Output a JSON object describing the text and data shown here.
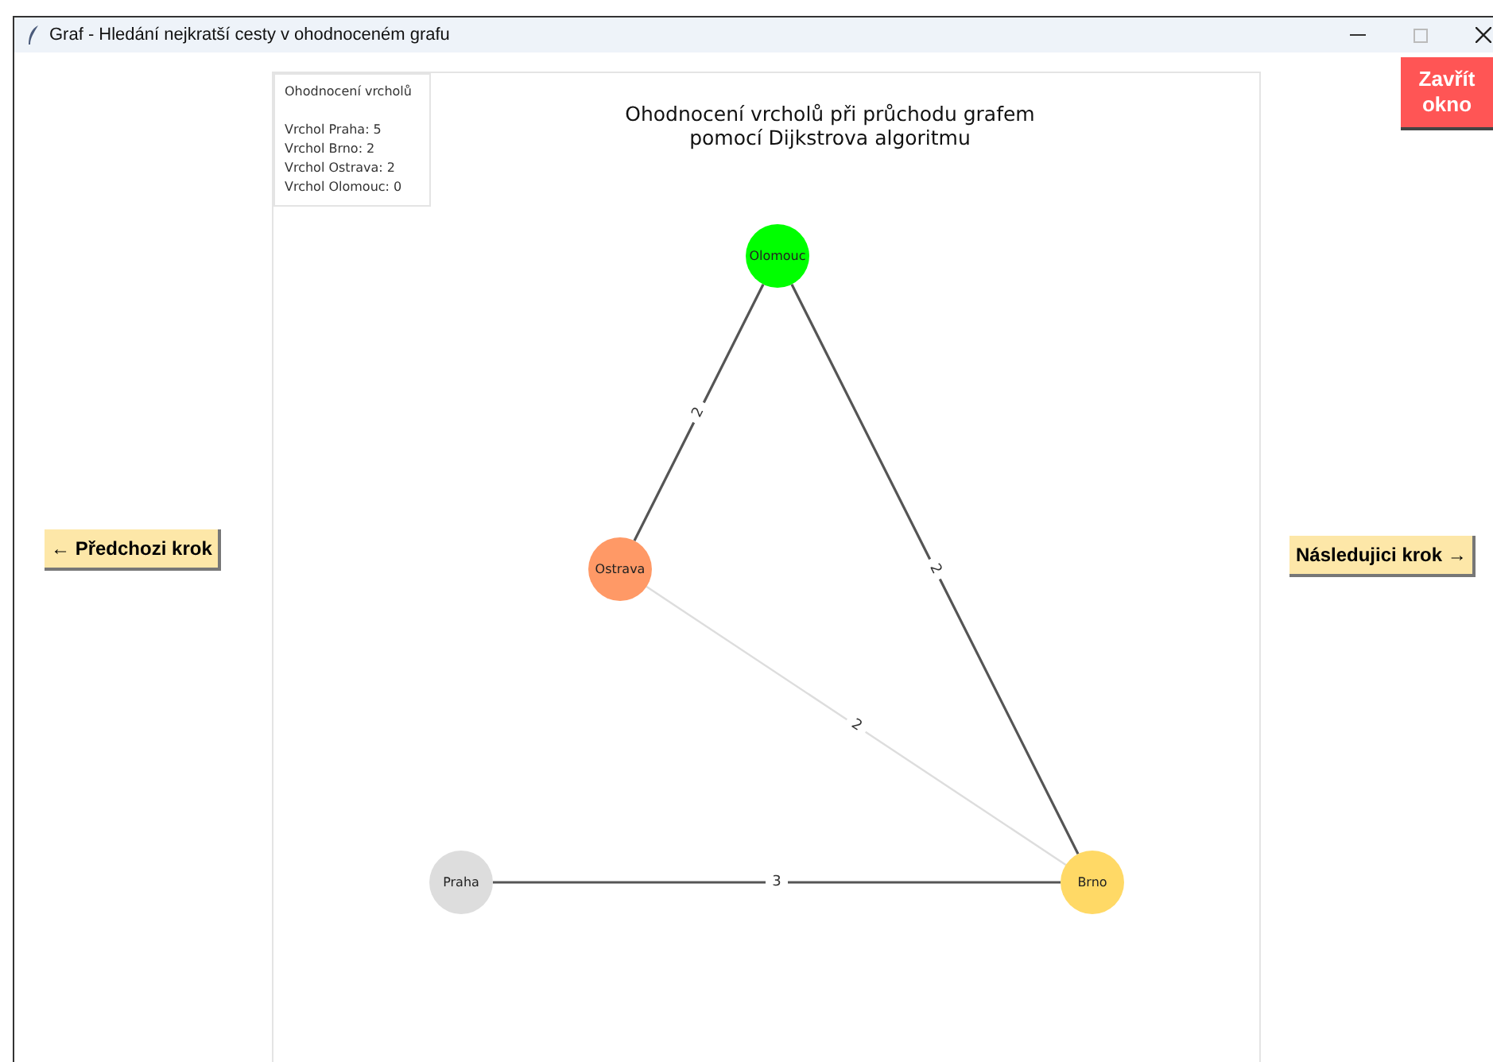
{
  "window": {
    "title": "Graf - Hledání nejkratší cesty v ohodnoceném grafu"
  },
  "close_button": {
    "label": "Zavřít okno"
  },
  "prev_button": {
    "label": "← Předchozi krok"
  },
  "next_button": {
    "label": "Následujici krok →"
  },
  "figure": {
    "title_lines": [
      "Ohodnocení vrcholů při průchodu grafem",
      "pomocí Dijkstrova algoritmu"
    ],
    "legend": {
      "title": "Ohodnocení vrcholů",
      "items": [
        "Vrchol Praha: 5",
        "Vrchol Brno: 2",
        "Vrchol Ostrava: 2",
        "Vrchol Olomouc: 0"
      ]
    },
    "nodes": [
      {
        "label": "Olomouc",
        "color": "#00ff00"
      },
      {
        "label": "Ostrava",
        "color": "#ff9966"
      },
      {
        "label": "Praha",
        "color": "#dddddd"
      },
      {
        "label": "Brno",
        "color": "#ffd966"
      }
    ],
    "edges": [
      {
        "weight": "2",
        "active": true
      },
      {
        "weight": "2",
        "active": true
      },
      {
        "weight": "2",
        "active": false
      },
      {
        "weight": "3",
        "active": true
      }
    ]
  }
}
